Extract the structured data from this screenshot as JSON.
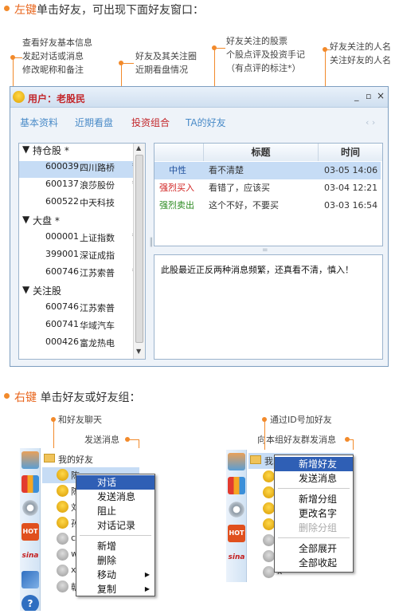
{
  "section1": {
    "key": "左键",
    "text": "单击好友，可出现下面好友窗口："
  },
  "section2": {
    "key": "右键",
    "text": "单击好友或好友组："
  },
  "annotations1": {
    "a1": [
      "查看好友基本信息",
      "发起对话或消息",
      "修改昵称和备注"
    ],
    "a2": [
      "好友及其关注圈",
      "近期看盘情况"
    ],
    "a3": [
      "好友关注的股票",
      "个股点评及投资手记",
      "（有点评的标注*）"
    ],
    "a4": [
      "好友关注的人名",
      "关注好友的人名"
    ]
  },
  "window": {
    "title": "用户：老股民",
    "controls": [
      "_",
      "▫",
      "×"
    ],
    "tabs": [
      "基本资料",
      "近期看盘",
      "投资组合",
      "TA的好友"
    ],
    "tree": [
      {
        "type": "group",
        "label": "持仓股 *"
      },
      {
        "type": "item",
        "code": "600039",
        "name": "四川路桥",
        "star": "*",
        "selected": true
      },
      {
        "type": "item",
        "code": "600137",
        "name": "浪莎股份",
        "star": "*"
      },
      {
        "type": "item",
        "code": "600522",
        "name": "中天科技",
        "star": ""
      },
      {
        "type": "group",
        "label": "大盘 *"
      },
      {
        "type": "item",
        "code": "000001",
        "name": "上证指数",
        "star": "*"
      },
      {
        "type": "item",
        "code": "399001",
        "name": "深证成指",
        "star": ""
      },
      {
        "type": "item",
        "code": "600746",
        "name": "江苏索普",
        "star": "*"
      },
      {
        "type": "group",
        "label": "关注股"
      },
      {
        "type": "item",
        "code": "600746",
        "name": "江苏索普",
        "star": ""
      },
      {
        "type": "item",
        "code": "600741",
        "name": "华域汽车",
        "star": ""
      },
      {
        "type": "item",
        "code": "000426",
        "name": "富龙热电",
        "star": ""
      }
    ],
    "table_headers": [
      "",
      "标题",
      "时间"
    ],
    "messages": [
      {
        "tag": "中性",
        "tag_color": "#1e4f9c",
        "title": "看不清楚",
        "time": "03-05 14:06",
        "selected": true
      },
      {
        "tag": "强烈买入",
        "tag_color": "#d0201f",
        "title": "看错了，应该买",
        "time": "03-04 12:21"
      },
      {
        "tag": "强烈卖出",
        "tag_color": "#2a8a1f",
        "title": "这个不好，不要买",
        "time": "03-03 16:54"
      }
    ],
    "detail": "此股最近正反两种消息频繁，还真看不清，慎入！"
  },
  "annotations2": {
    "left_a": "和好友聊天",
    "left_b": "发送消息",
    "right_a": "通过ID号加好友",
    "right_b": "向本组好友群发消息"
  },
  "left_panel": {
    "group": "我的好友",
    "friends": [
      "陈",
      "陈安",
      "刘",
      "孙",
      "cfc",
      "wu",
      "xi",
      "朝末"
    ],
    "menu": [
      "对话",
      "发送消息",
      "阻止",
      "对话记录",
      "新增",
      "删除",
      "移动",
      "复制"
    ]
  },
  "right_panel": {
    "group": "我的好",
    "friends": [
      "陈",
      "陈",
      "刘",
      "孙",
      "c",
      "w",
      "x"
    ],
    "menu": [
      "新增好友",
      "发送消息",
      "新增分组",
      "更改名字",
      "删除分组",
      "全部展开",
      "全部收起"
    ]
  },
  "colors": {
    "accent": "#f28a2b",
    "red": "#c3272b",
    "blue": "#4a8bc8",
    "selection": "#2f5fb5"
  }
}
